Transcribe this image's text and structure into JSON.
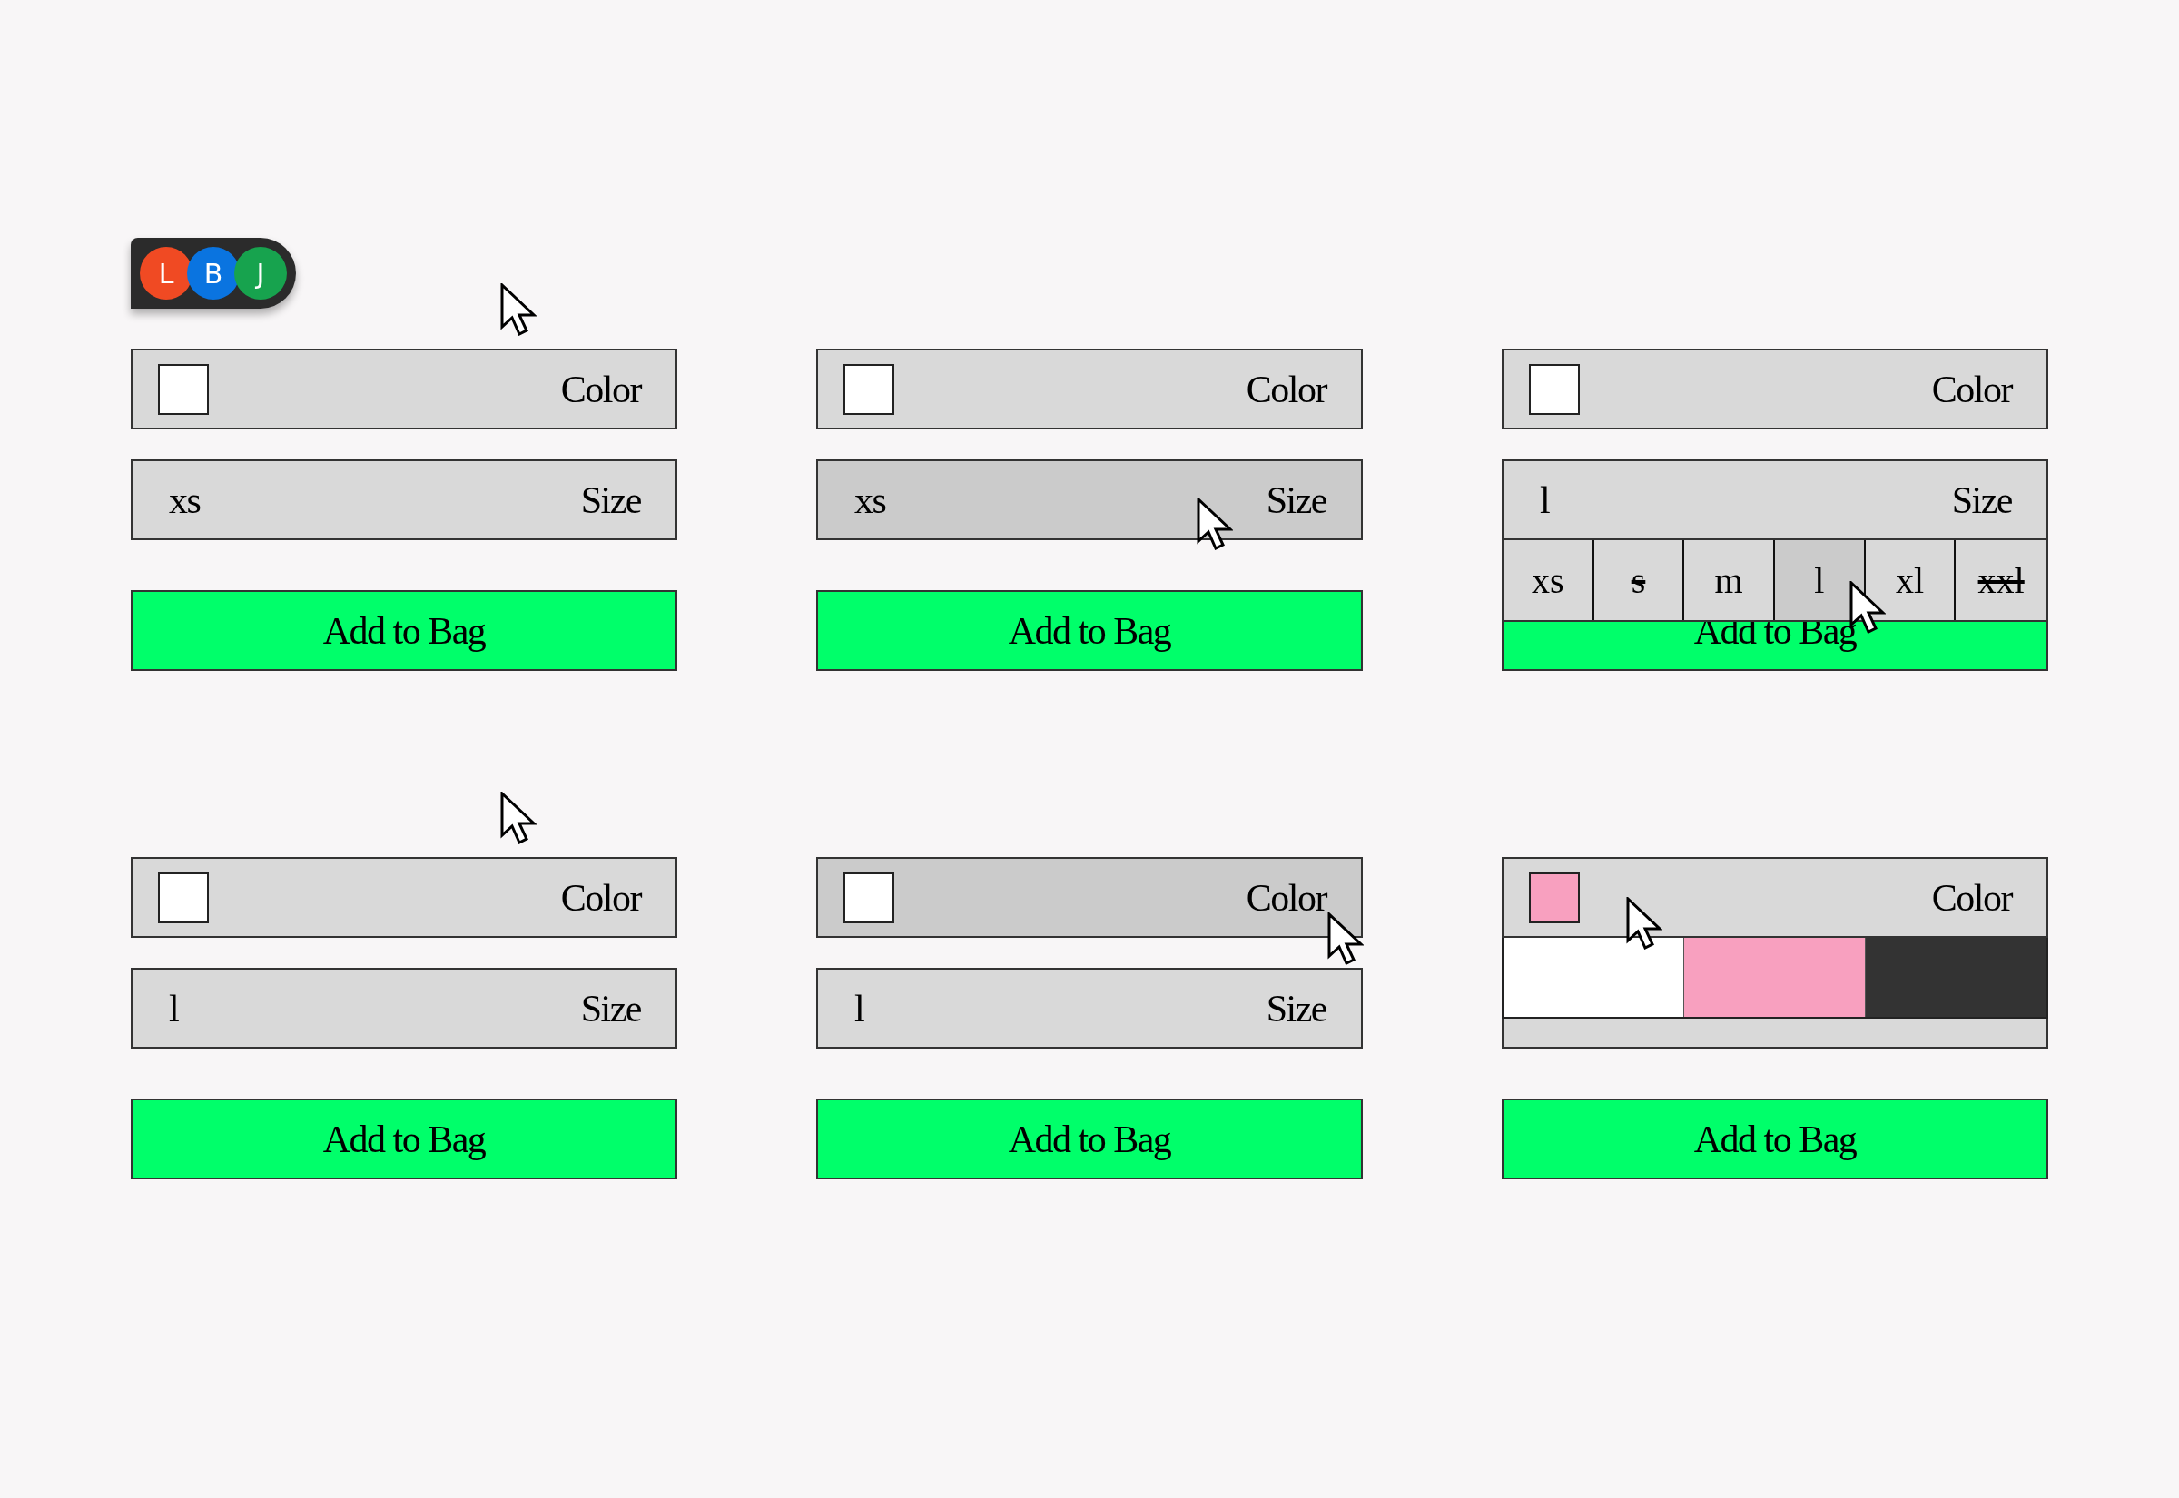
{
  "avatars": [
    {
      "label": "L",
      "color": "#f04a23"
    },
    {
      "label": "B",
      "color": "#0a74e0"
    },
    {
      "label": "J",
      "color": "#17a34e"
    }
  ],
  "panels": [
    {
      "kind": "above",
      "color": {
        "label": "Color",
        "color": "#ffffff",
        "hovered": false
      },
      "size": {
        "value": "xs",
        "label": "Size",
        "hovered": false
      },
      "button": "Add to Bag"
    },
    {
      "kind": "size",
      "color": {
        "label": "Color",
        "color": "#ffffff",
        "hovered": false
      },
      "size": {
        "value": "xs",
        "label": "Size",
        "hovered": true
      },
      "button": "Add to Bag"
    },
    {
      "kind": "size-option",
      "color": {
        "label": "Color",
        "color": "#ffffff",
        "hovered": false
      },
      "size": {
        "value": "l",
        "label": "Size",
        "hovered": false,
        "expanded": true,
        "options": [
          {
            "label": "xs",
            "selected": false,
            "disabled": false
          },
          {
            "label": "s",
            "selected": false,
            "disabled": true
          },
          {
            "label": "m",
            "selected": false,
            "disabled": false
          },
          {
            "label": "l",
            "selected": true,
            "disabled": false
          },
          {
            "label": "xl",
            "selected": false,
            "disabled": false
          },
          {
            "label": "xxl",
            "selected": false,
            "disabled": true
          }
        ]
      },
      "button": "Add to Bag"
    },
    {
      "kind": "above",
      "color": {
        "label": "Color",
        "color": "#ffffff",
        "hovered": false
      },
      "size": {
        "value": "l",
        "label": "Size",
        "hovered": false
      },
      "button": "Add to Bag"
    },
    {
      "kind": "color",
      "color": {
        "label": "Color",
        "color": "#ffffff",
        "hovered": true
      },
      "size": {
        "value": "l",
        "label": "Size",
        "hovered": false
      },
      "button": "Add to Bag"
    },
    {
      "kind": "color-option",
      "color": {
        "label": "Color",
        "color": "#f8a0bf",
        "hovered": false,
        "expanded": true,
        "options": [
          {
            "color": "#ffffff"
          },
          {
            "color": "#f8a0bf"
          },
          {
            "color": "#333333"
          }
        ]
      },
      "size": {
        "hovered": false
      },
      "button": "Add to Bag"
    }
  ]
}
